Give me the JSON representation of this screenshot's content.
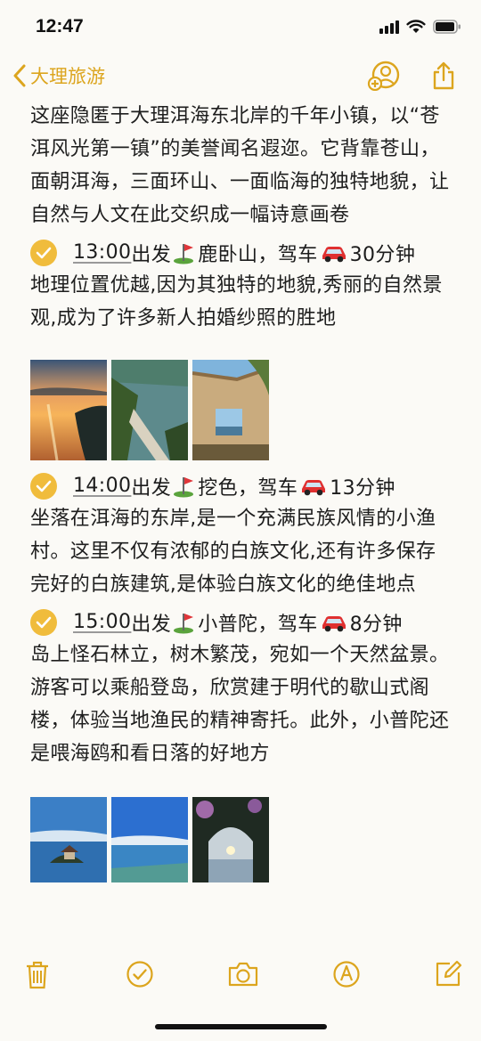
{
  "status_bar": {
    "time": "12:47"
  },
  "nav": {
    "back_label": "大理旅游"
  },
  "note": {
    "intro": "这座隐匿于大理洱海东北岸的千年小镇，以“苍洱风光第一镇”的美誉闻名遐迩。它背靠苍山，面朝洱海，三面环山、一面临海的独特地貌，让自然与人文在此交织成一幅诗意画卷",
    "items": [
      {
        "time": "13:00",
        "depart": "出发",
        "place": "鹿卧山，驾车",
        "duration": "30分钟",
        "desc": "地理位置优越,因为其独特的地貌,秀丽的自然景观,成为了许多新人拍婚纱照的胜地"
      },
      {
        "time": "14:00",
        "depart": "出发",
        "place": "挖色，驾车",
        "duration": "13分钟",
        "desc": "坐落在洱海的东岸,是一个充满民族风情的小渔村。这里不仅有浓郁的白族文化,还有许多保存完好的白族建筑,是体验白族文化的绝佳地点"
      },
      {
        "time": "15:00",
        "depart": "出发",
        "place": "小普陀，驾车",
        "duration": "8分钟",
        "desc": "岛上怪石林立，树木繁茂，宛如一个天然盆景。游客可以乘船登岛，欣赏建于明代的歇山式阁楼，体验当地渔民的精神寄托。此外，小普陀还是喂海鸥和看日落的好地方"
      }
    ]
  },
  "colors": {
    "accent": "#dca51e",
    "check": "#f0bc3c",
    "background": "#fbfaf6"
  },
  "icons": {
    "back": "chevron-left-icon",
    "share_user": "add-person-icon",
    "share": "share-icon",
    "emoji_golf": "golf-flag-icon",
    "emoji_car": "car-icon",
    "toolbar": [
      "trash-icon",
      "checklist-icon",
      "camera-icon",
      "markup-icon",
      "compose-icon"
    ]
  }
}
